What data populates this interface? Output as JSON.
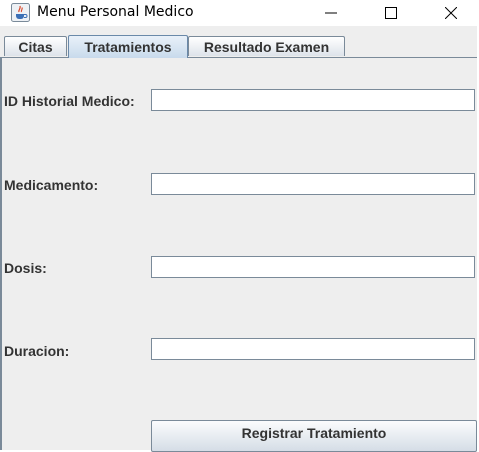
{
  "window": {
    "title": "Menu Personal Medico",
    "controls": {
      "minimize": "—",
      "maximize": "☐",
      "close": "✕"
    }
  },
  "tabs": [
    {
      "label": "Citas",
      "selected": false
    },
    {
      "label": "Tratamientos",
      "selected": true
    },
    {
      "label": "Resultado Examen",
      "selected": false
    }
  ],
  "form": {
    "fields": [
      {
        "label": "ID Historial Medico:",
        "value": ""
      },
      {
        "label": "Medicamento:",
        "value": ""
      },
      {
        "label": "Dosis:",
        "value": ""
      },
      {
        "label": "Duracion:",
        "value": ""
      }
    ],
    "submit_label": "Registrar Tratamiento"
  },
  "icons": {
    "app_icon": "java-cup-icon",
    "minimize": "minimize-icon",
    "maximize": "maximize-icon",
    "close": "close-icon"
  }
}
